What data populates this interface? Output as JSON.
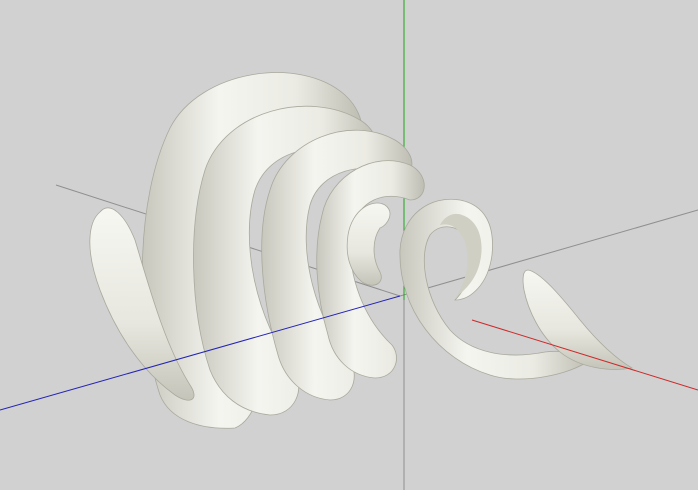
{
  "scene": {
    "background_color": "#d1d1d1",
    "object": "spiral-seashell-mesh",
    "shell_color": "#f2f2ec",
    "shell_shadow_color": "#b9b9ad",
    "axes": [
      {
        "name": "x-axis",
        "color": "#cc2a2a"
      },
      {
        "name": "y-axis",
        "color": "#1ca81c"
      },
      {
        "name": "z-axis",
        "color": "#2323b8"
      },
      {
        "name": "helper-axis",
        "color": "#8f8f8f"
      }
    ]
  }
}
